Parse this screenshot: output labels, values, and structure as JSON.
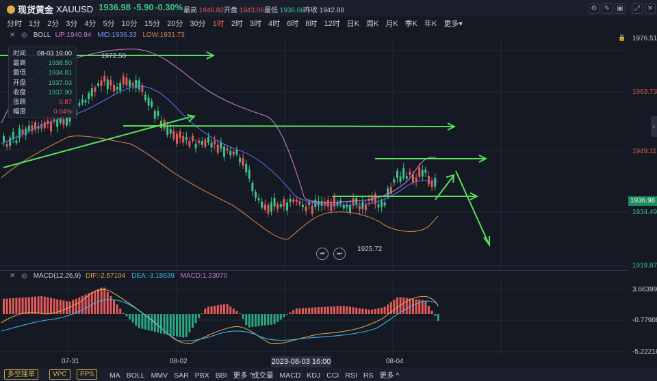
{
  "header": {
    "symbol_name": "现货黄金",
    "symbol_code": "XAUUSD",
    "price": "1936.98",
    "change": "-5.90",
    "change_pct": "-0.30%",
    "high_label": "最高",
    "high_value": "1946.82",
    "open_label": "开盘",
    "open_value": "1943.06",
    "low_label": "最低",
    "low_value": "1936.66",
    "prev_close_label": "昨收",
    "prev_close_value": "1942.88"
  },
  "toolbar_icons": [
    "chart-settings-icon",
    "draw-icon",
    "window-icon",
    "expand-icon",
    "close-icon"
  ],
  "periods": {
    "items": [
      "分时",
      "1分",
      "2分",
      "3分",
      "4分",
      "5分",
      "10分",
      "15分",
      "20分",
      "30分",
      "1时",
      "2时",
      "3时",
      "4时",
      "6时",
      "8时",
      "12时",
      "日K",
      "周K",
      "月K",
      "季K",
      "年K",
      "更多"
    ],
    "active_index": 10
  },
  "boll_legend": {
    "name": "BOLL",
    "up": "UP:1940.94",
    "mid": "MID:1936.33",
    "low": "LOW:1931.73"
  },
  "macd_legend": {
    "name": "MACD(12,26,9)",
    "dif": "DIF:-2.57104",
    "dea": "DEA:-3.18639",
    "macd": "MACD:1.23070"
  },
  "infobox": {
    "rows": [
      {
        "k": "时间",
        "v": "08-03 16:00"
      },
      {
        "k": "最高",
        "v": "1938.50"
      },
      {
        "k": "最低",
        "v": "1934.81"
      },
      {
        "k": "开盘",
        "v": "1937.03"
      },
      {
        "k": "收盘",
        "v": "1937.90"
      },
      {
        "k": "涨跌",
        "v": "0.87"
      },
      {
        "k": "幅度",
        "v": "0.04%"
      }
    ]
  },
  "price_axis": {
    "labels": [
      "1976.51",
      "1963.73",
      "1949.11",
      "1934.49",
      "1919.87"
    ],
    "current": "1936.98"
  },
  "macd_axis": {
    "labels": [
      "3.66399",
      "-0.77908",
      "-5.22216"
    ]
  },
  "chart_annotations": {
    "high_mark": "1972.50",
    "low_mark": "1925.72"
  },
  "time_axis": {
    "labels": [
      "07-31",
      "08-02",
      "08-04"
    ],
    "crosshair": "2023-08-03 16:00"
  },
  "bottom_bar": {
    "buttons": [
      "多空挂单",
      "VPC",
      "PPS"
    ],
    "main_indicators": [
      "MA",
      "BOLL",
      "MMV",
      "SAR",
      "PBX",
      "BBI",
      "更多"
    ],
    "sub_indicators": [
      "成交量",
      "MACD",
      "KDJ",
      "CCI",
      "RSI",
      "RS",
      "更多"
    ]
  },
  "colors": {
    "up": "#e65a5a",
    "down": "#3ec18a",
    "boll_up": "#c779d0",
    "boll_mid": "#5b6de0",
    "boll_low": "#c8824a",
    "annotation": "#58e05a"
  }
}
